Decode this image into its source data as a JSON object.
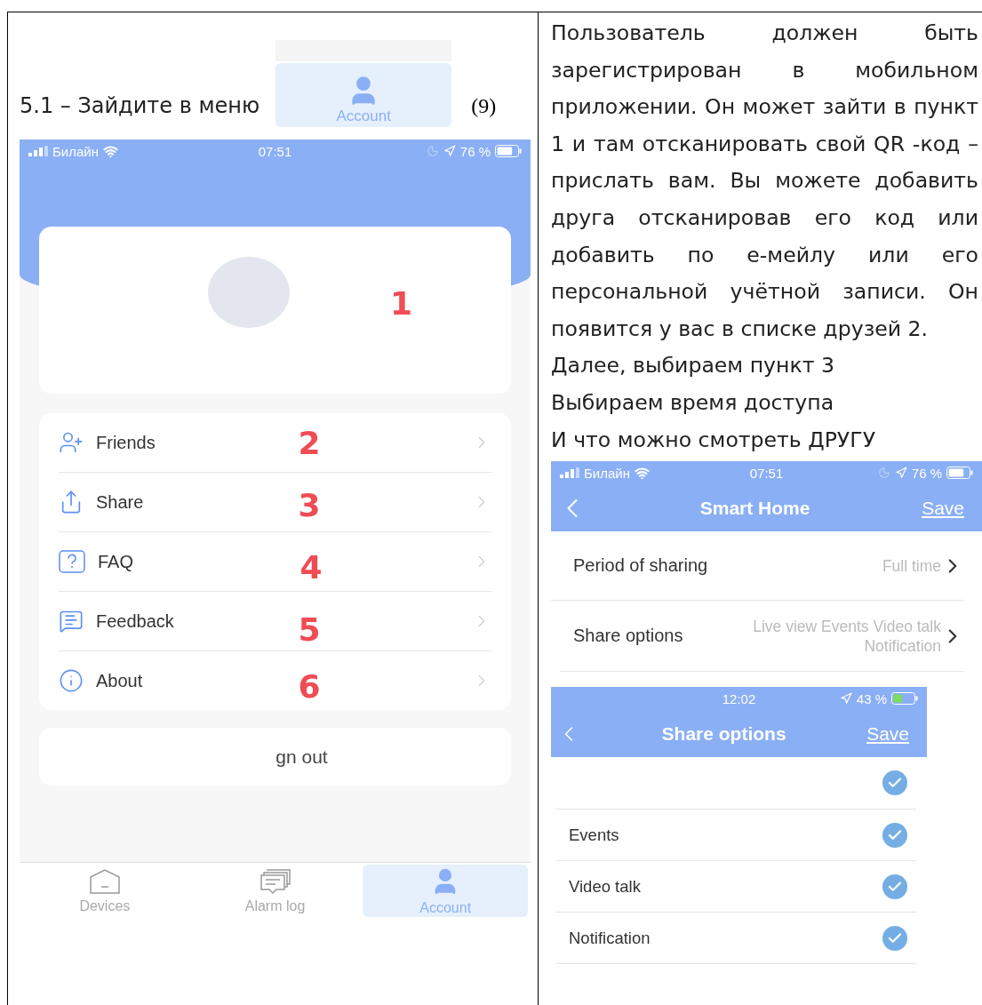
{
  "left": {
    "heading": "5.1 – Зайдите в меню",
    "tab_preview": {
      "label": "Account"
    },
    "ref": "(9)",
    "phone": {
      "status": {
        "carrier": "Билайн",
        "time": "07:51",
        "battery": "76 %"
      },
      "profile_marker": "1",
      "menu": [
        {
          "label": "Friends",
          "marker": "2"
        },
        {
          "label": "Share",
          "marker": "3"
        },
        {
          "label": "FAQ",
          "marker": "4"
        },
        {
          "label": "Feedback",
          "marker": "5"
        },
        {
          "label": "About",
          "marker": "6"
        }
      ],
      "sign_out": "gn out",
      "tabs": [
        {
          "label": "Devices",
          "selected": false
        },
        {
          "label": "Alarm log",
          "selected": false
        },
        {
          "label": "Account",
          "selected": true
        }
      ]
    }
  },
  "right": {
    "paragraphs": [
      "Пользователь должен быть зарегистрирован в мобильном приложении. Он может зайти в пункт 1 и там отсканировать свой QR -код – прислать вам. Вы можете добавить друга отсканировав его код или добавить по е-мейлу или его персональной учётной записи. Он появится у вас в списке друзей 2.",
      "Далее, выбираем пункт 3",
      "Выбираем время доступа",
      "И что можно смотреть ДРУГУ"
    ],
    "settings_screen": {
      "status": {
        "carrier": "Билайн",
        "time": "07:51",
        "battery": "76 %"
      },
      "title": "Smart Home",
      "save": "Save",
      "rows": [
        {
          "label": "Period of sharing",
          "value": "Full time"
        },
        {
          "label": "Share options",
          "value": "Live view Events Video talk Notification"
        }
      ]
    },
    "options_screen": {
      "status": {
        "time": "12:02",
        "battery": "43 %"
      },
      "title": "Share options",
      "save": "Save",
      "rows": [
        {
          "checked": true
        },
        {
          "label": "Events",
          "checked": true
        },
        {
          "label": "Video talk",
          "checked": true
        },
        {
          "label": "Notification",
          "checked": true
        }
      ]
    }
  }
}
